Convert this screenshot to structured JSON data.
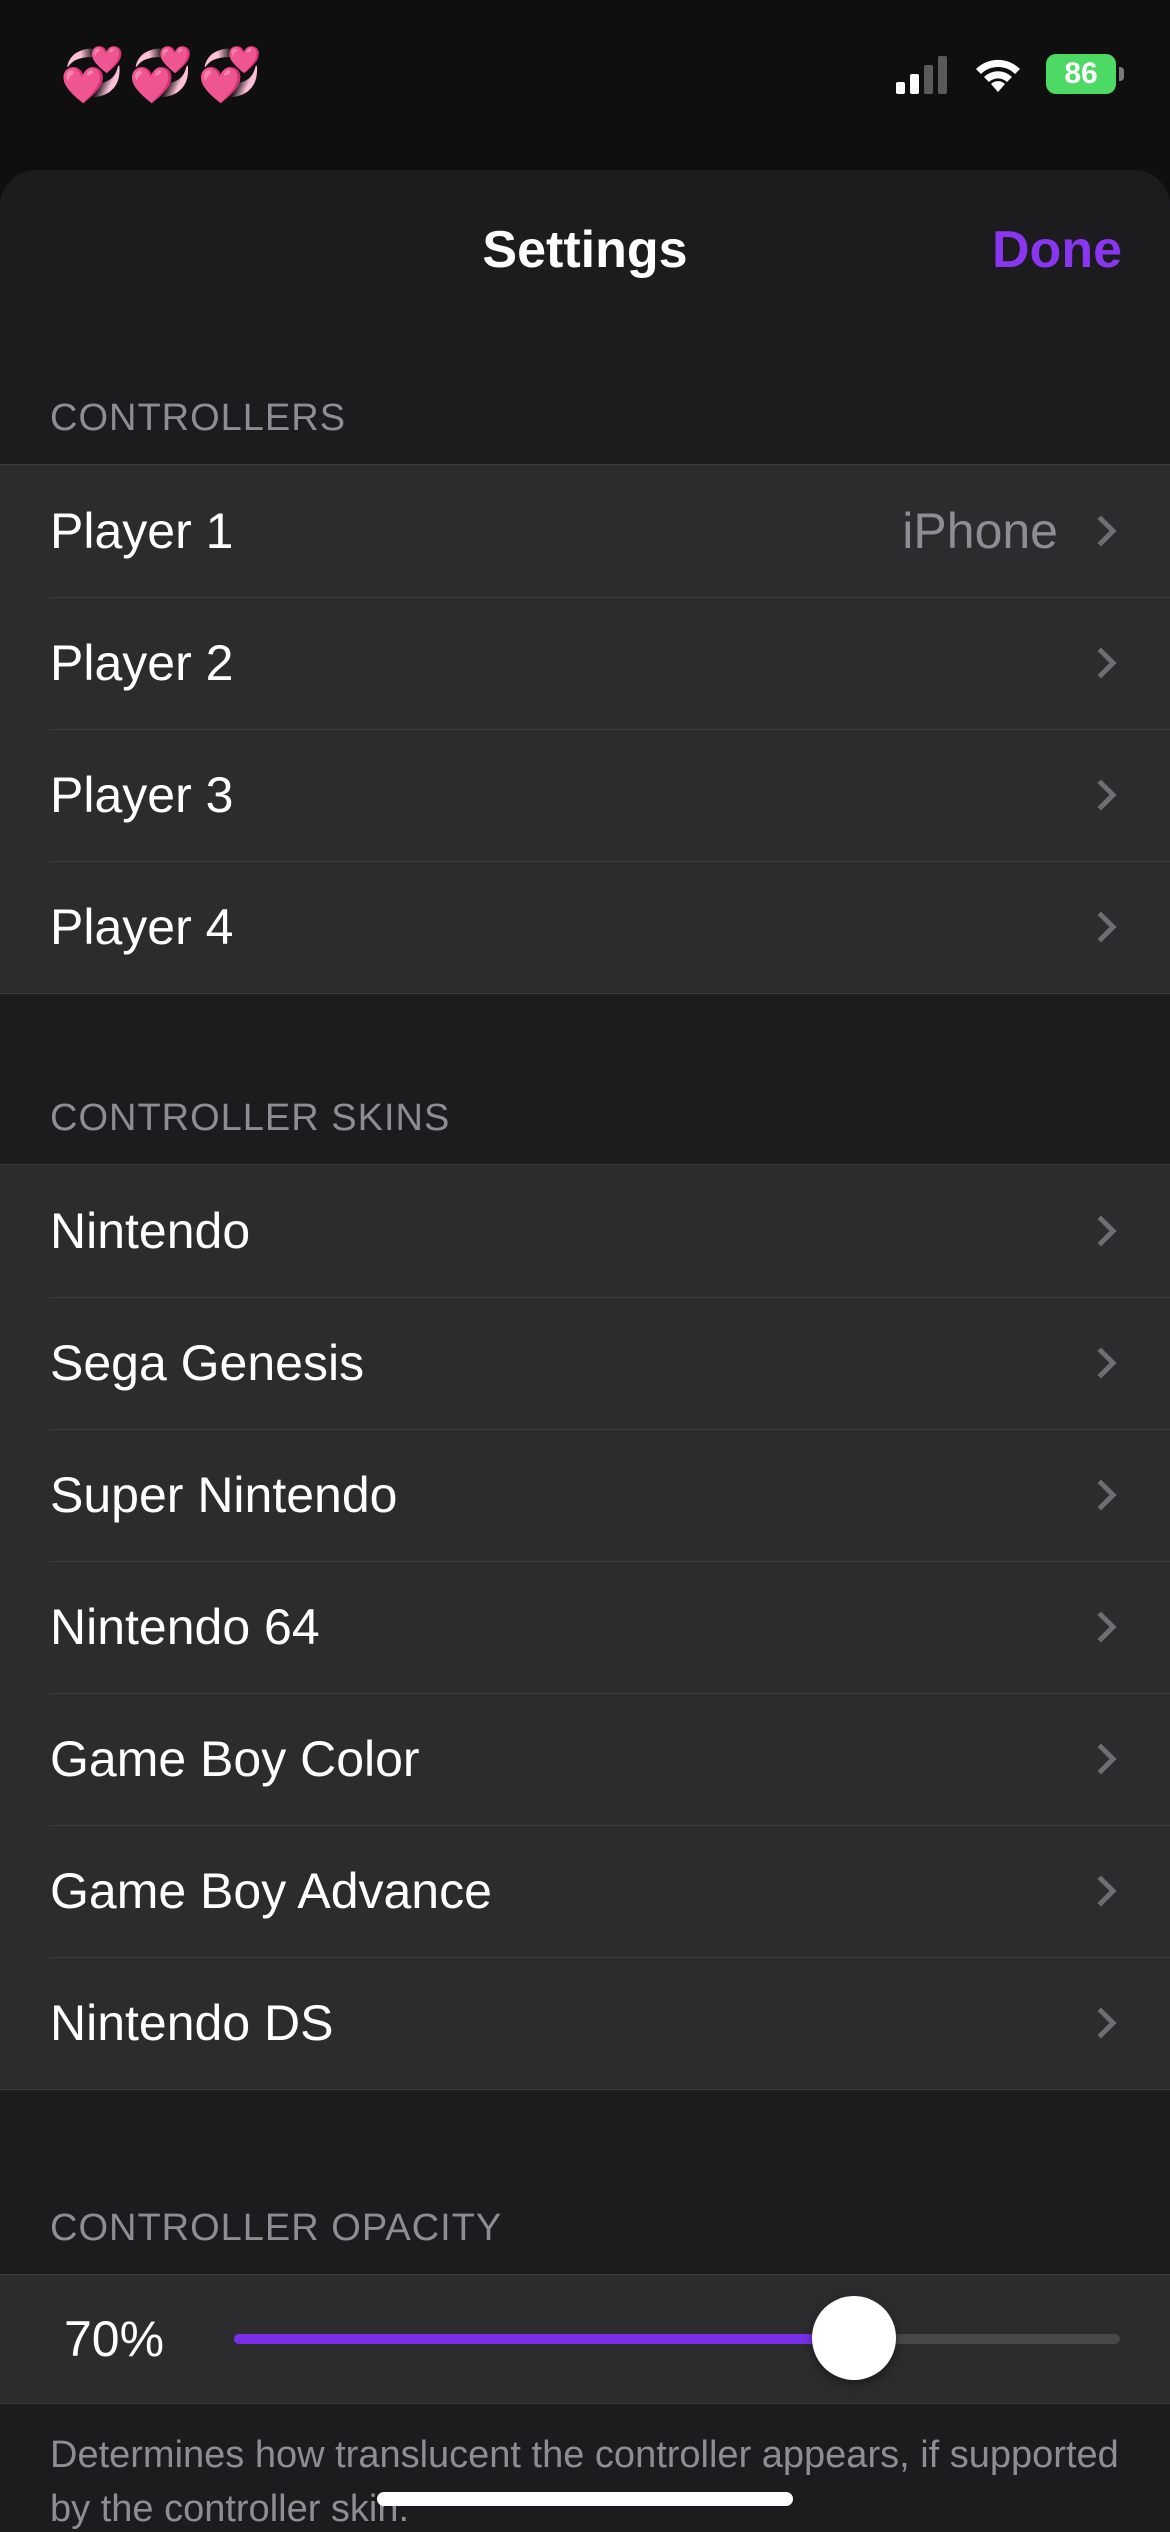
{
  "status_bar": {
    "emoji": "💞💞💞",
    "battery_level": "86",
    "icons": [
      "signal-icon",
      "wifi-icon",
      "battery-charging-icon"
    ]
  },
  "nav": {
    "title": "Settings",
    "done_label": "Done",
    "accent_color": "#8a35f0"
  },
  "controllers": {
    "header": "CONTROLLERS",
    "rows": [
      {
        "label": "Player 1",
        "value": "iPhone"
      },
      {
        "label": "Player 2",
        "value": ""
      },
      {
        "label": "Player 3",
        "value": ""
      },
      {
        "label": "Player 4",
        "value": ""
      }
    ]
  },
  "controller_skins": {
    "header": "CONTROLLER SKINS",
    "rows": [
      {
        "label": "Nintendo"
      },
      {
        "label": "Sega Genesis"
      },
      {
        "label": "Super Nintendo"
      },
      {
        "label": "Nintendo 64"
      },
      {
        "label": "Game Boy Color"
      },
      {
        "label": "Game Boy Advance"
      },
      {
        "label": "Nintendo DS"
      }
    ]
  },
  "controller_opacity": {
    "header": "CONTROLLER OPACITY",
    "value_label": "70%",
    "value": 0.7,
    "footnote": "Determines how translucent the controller appears, if supported by the controller skin."
  }
}
